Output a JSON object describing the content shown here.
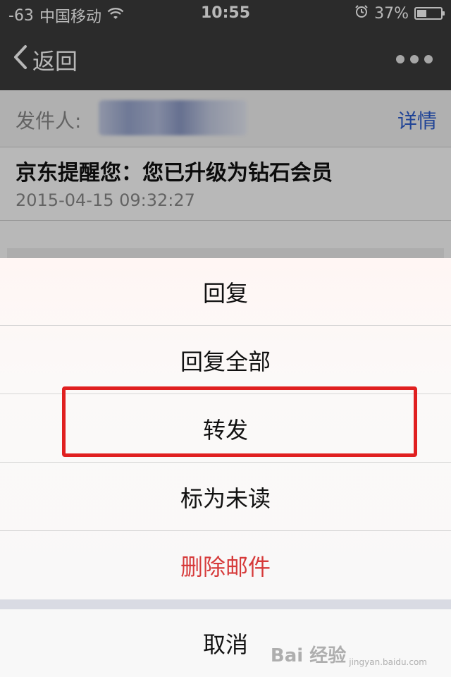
{
  "status_bar": {
    "signal": "-63",
    "carrier": "中国移动",
    "time": "10:55",
    "battery": "37%",
    "icons": [
      "wifi-icon",
      "alarm-icon",
      "battery-icon"
    ]
  },
  "nav": {
    "back_label": "返回",
    "back_icon": "chevron-left-icon",
    "more_icon": "more-dots-icon"
  },
  "mail": {
    "sender_label": "发件人:",
    "details_label": "详情",
    "subject": "京东提醒您：您已升级为钻石会员",
    "date": "2015-04-15 09:32:27"
  },
  "action_sheet": {
    "items": [
      {
        "label": "回复"
      },
      {
        "label": "回复全部"
      },
      {
        "label": "转发"
      },
      {
        "label": "标为未读"
      },
      {
        "label": "删除邮件"
      }
    ],
    "cancel_label": "取消"
  },
  "watermark": {
    "main": "Bai 经验",
    "sub": "jingyan.baidu.com"
  },
  "colors": {
    "bar": "#3c3c3c",
    "link": "#2f5fd0",
    "destructive": "#d63a3a",
    "highlight": "#e02020"
  }
}
